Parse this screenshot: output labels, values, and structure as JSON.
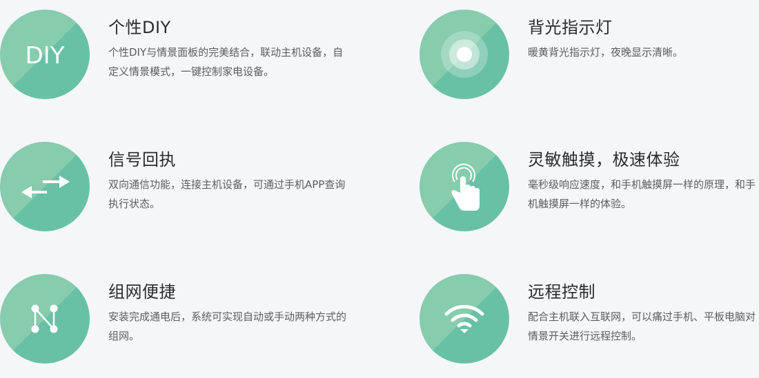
{
  "features": [
    {
      "title": "个性DIY",
      "desc": "个性DIY与情景面板的完美结合，联动主机设备，自定义情景模式，一键控制家电设备。",
      "icon": "diy-icon",
      "icon_text": "DIY"
    },
    {
      "title": "背光指示灯",
      "desc": "暖黄背光指示灯，夜晚显示清晰。",
      "icon": "backlight-icon"
    },
    {
      "title": "信号回执",
      "desc": "双向通信功能，连接主机设备，可通过手机APP查询执行状态。",
      "icon": "two-way-arrows-icon"
    },
    {
      "title": "灵敏触摸，极速体验",
      "desc": "毫秒级响应速度，和手机触摸屏一样的原理，和手机触摸屏一样的体验。",
      "icon": "touch-hand-icon"
    },
    {
      "title": "组网便捷",
      "desc": "安装完成通电后，系统可实现自动或手动两种方式的组网。",
      "icon": "network-nodes-icon"
    },
    {
      "title": "远程控制",
      "desc": "配合主机联入互联网，可以痛过手机、平板电脑对情景开关进行远程控制。",
      "icon": "wifi-icon"
    }
  ],
  "colors": {
    "circle_light": "#86ccad",
    "circle_dark": "#68c1a5",
    "title": "#2b2b2b",
    "desc": "#5c5c5c"
  }
}
